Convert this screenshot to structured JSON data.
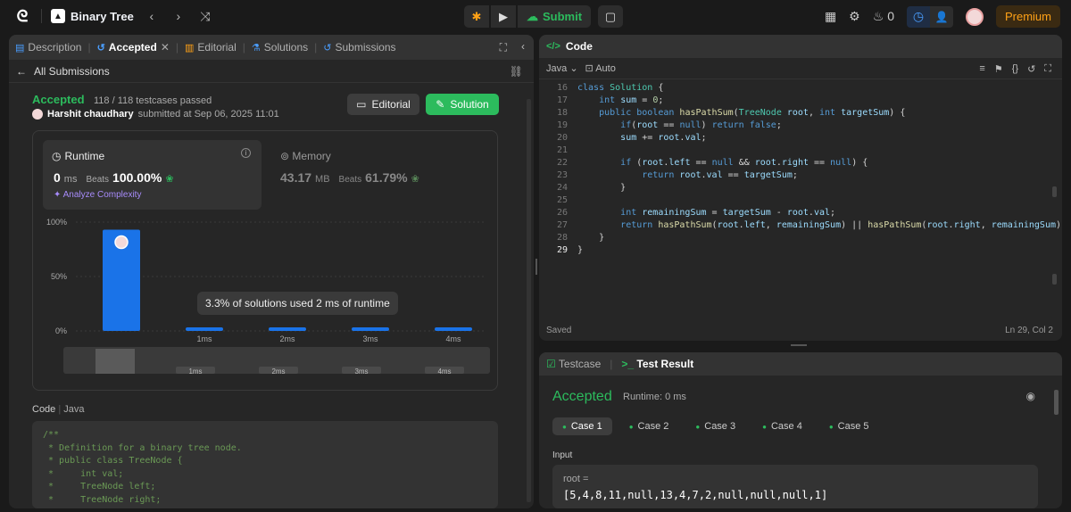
{
  "topbar": {
    "problem_list": "Binary Tree",
    "submit": "Submit",
    "streak": "0",
    "premium": "Premium"
  },
  "left_tabs": [
    {
      "label": "Description"
    },
    {
      "label": "Accepted"
    },
    {
      "label": "Editorial"
    },
    {
      "label": "Solutions"
    },
    {
      "label": "Submissions"
    }
  ],
  "submission": {
    "back_label": "All Submissions",
    "status": "Accepted",
    "testcases": "118 / 118 testcases passed",
    "user": "Harshit chaudhary",
    "submitted_at": "submitted at Sep 06, 2025 11:01",
    "editorial_btn": "Editorial",
    "solution_btn": "Solution"
  },
  "runtime": {
    "title": "Runtime",
    "value": "0",
    "unit": "ms",
    "beats_label": "Beats",
    "beats": "100.00%",
    "analyze": "Analyze Complexity"
  },
  "memory": {
    "title": "Memory",
    "value": "43.17",
    "unit": "MB",
    "beats_label": "Beats",
    "beats": "61.79%"
  },
  "chart_data": {
    "type": "bar",
    "categories": [
      "0ms",
      "1ms",
      "2ms",
      "3ms",
      "4ms"
    ],
    "x_labels_shown": [
      "",
      "1ms",
      "2ms",
      "3ms",
      "4ms"
    ],
    "values": [
      93,
      3.3,
      3.3,
      3.3,
      3.3
    ],
    "y_ticks": [
      "100%",
      "50%",
      "0%"
    ],
    "ylim": [
      0,
      100
    ],
    "highlight_category": "0ms",
    "bar_color": "#1a73e8",
    "tooltip": "3.3% of solutions used 2 ms of runtime",
    "minimap_labels": [
      "1ms",
      "2ms",
      "3ms",
      "4ms"
    ]
  },
  "submitted_code": {
    "label": "Code",
    "lang": "Java",
    "lines": [
      "/**",
      " * Definition for a binary tree node.",
      " * public class TreeNode {",
      " *     int val;",
      " *     TreeNode left;",
      " *     TreeNode right;"
    ]
  },
  "editor": {
    "title": "Code",
    "lang": "Java",
    "mode": "Auto",
    "status": "Saved",
    "cursor": "Ln 29, Col 2"
  },
  "test": {
    "tab_testcase": "Testcase",
    "tab_result": "Test Result",
    "status": "Accepted",
    "runtime": "Runtime: 0 ms",
    "cases": [
      "Case 1",
      "Case 2",
      "Case 3",
      "Case 4",
      "Case 5"
    ],
    "input_label": "Input",
    "input_name": "root =",
    "input_value": "[5,4,8,11,null,13,4,7,2,null,null,null,1]"
  }
}
